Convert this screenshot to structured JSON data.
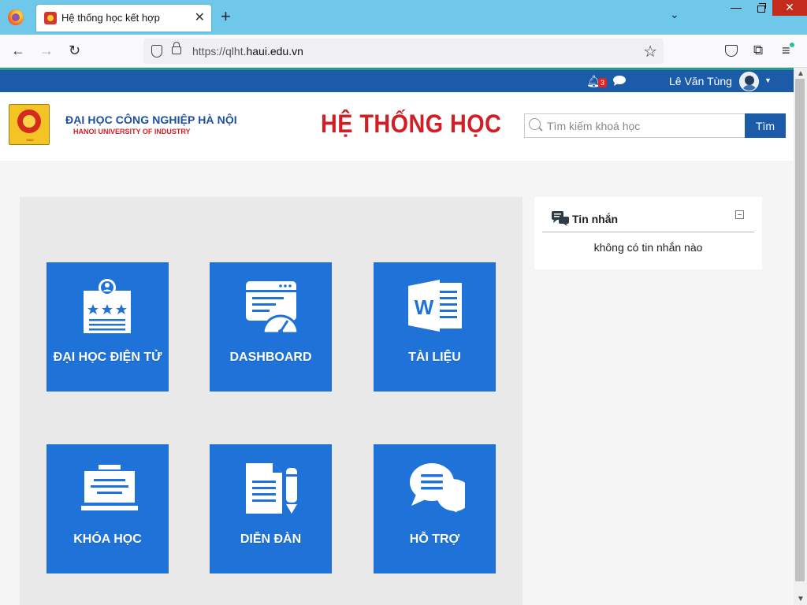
{
  "browser": {
    "tab_title": "Hệ thống học kết hợp",
    "url_prefix": "https://qlht.",
    "url_domain": "haui.edu.vn"
  },
  "topbar": {
    "notification_count": "3",
    "username": "Lê Văn Tùng"
  },
  "header": {
    "university_vn": "ĐẠI HỌC CÔNG NGHIỆP HÀ NỘI",
    "university_en": "HANOI UNIVERSITY OF INDUSTRY",
    "site_title": "HỆ THỐNG HỌC KẾT HỢP",
    "logo_text": "HaUI"
  },
  "search": {
    "placeholder": "Tìm kiếm khoá học",
    "button_label": "Tìm"
  },
  "tiles": [
    {
      "label": "ĐẠI HỌC ĐIỆN TỬ",
      "icon": "certificate-icon"
    },
    {
      "label": "DASHBOARD",
      "icon": "dashboard-gauge-icon"
    },
    {
      "label": "TÀI LIỆU",
      "icon": "word-document-icon"
    },
    {
      "label": "KHÓA HỌC",
      "icon": "course-board-icon"
    },
    {
      "label": "DIỄN ĐÀN",
      "icon": "forum-document-pencil-icon"
    },
    {
      "label": "HỖ TRỢ",
      "icon": "support-chat-icon"
    }
  ],
  "messages": {
    "title": "Tin nhắn",
    "empty_text": "không có tin nhắn nào"
  },
  "colors": {
    "topbar": "#1c5ba8",
    "tile": "#1f73d8",
    "title_red": "#d21f26",
    "browser_tabbar": "#6fc8ea"
  }
}
